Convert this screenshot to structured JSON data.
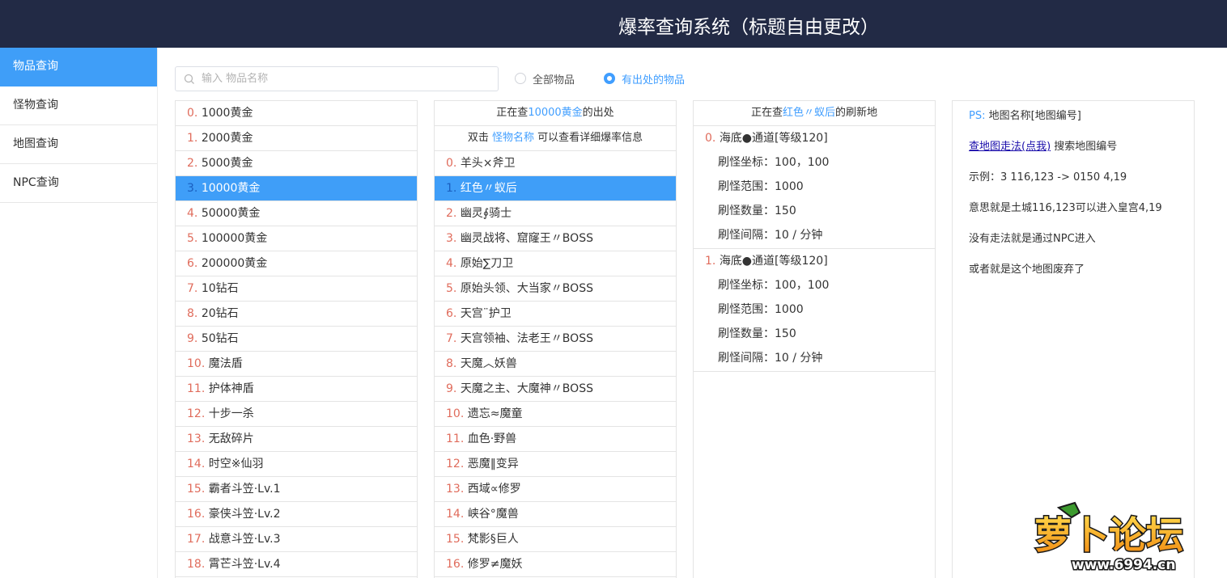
{
  "header": {
    "title": "爆率查询系统（标题自由更改）"
  },
  "sidebar": {
    "items": [
      {
        "label": "物品查询",
        "active": true
      },
      {
        "label": "怪物查询",
        "active": false
      },
      {
        "label": "地图查询",
        "active": false
      },
      {
        "label": "NPC查询",
        "active": false
      }
    ]
  },
  "search": {
    "placeholder": "输入 物品名称",
    "value": ""
  },
  "filters": {
    "all_label": "全部物品",
    "source_label": "有出处的物品",
    "selected": "source"
  },
  "items_list": [
    {
      "index": "0.",
      "name": "1000黄金"
    },
    {
      "index": "1.",
      "name": "2000黄金"
    },
    {
      "index": "2.",
      "name": "5000黄金"
    },
    {
      "index": "3.",
      "name": "10000黄金",
      "selected": true
    },
    {
      "index": "4.",
      "name": "50000黄金"
    },
    {
      "index": "5.",
      "name": "100000黄金"
    },
    {
      "index": "6.",
      "name": "200000黄金"
    },
    {
      "index": "7.",
      "name": "10钻石"
    },
    {
      "index": "8.",
      "name": "20钻石"
    },
    {
      "index": "9.",
      "name": "50钻石"
    },
    {
      "index": "10.",
      "name": "魔法盾"
    },
    {
      "index": "11.",
      "name": "护体神盾"
    },
    {
      "index": "12.",
      "name": "十步一杀"
    },
    {
      "index": "13.",
      "name": "无敌碎片"
    },
    {
      "index": "14.",
      "name": "时空※仙羽"
    },
    {
      "index": "15.",
      "name": "霸者斗笠·Lv.1"
    },
    {
      "index": "16.",
      "name": "豪侠斗笠·Lv.2"
    },
    {
      "index": "17.",
      "name": "战意斗笠·Lv.3"
    },
    {
      "index": "18.",
      "name": "霄芒斗笠·Lv.4"
    }
  ],
  "monsters_panel": {
    "head_prefix": "正在查",
    "head_item": "10000黄金",
    "head_suffix": "的出处",
    "hint_prefix": "双击 ",
    "hint_link": "怪物名称",
    "hint_suffix": " 可以查看详细爆率信息",
    "list": [
      {
        "index": "0.",
        "name": "羊头×斧卫"
      },
      {
        "index": "1.",
        "name": "红色〃蚁后",
        "selected": true
      },
      {
        "index": "2.",
        "name": "幽灵∮骑士"
      },
      {
        "index": "3.",
        "name": "幽灵战将、窟窿王〃BOSS"
      },
      {
        "index": "4.",
        "name": "原始∑刀卫"
      },
      {
        "index": "5.",
        "name": "原始头领、大当家〃BOSS"
      },
      {
        "index": "6.",
        "name": "天宫¨护卫"
      },
      {
        "index": "7.",
        "name": "天宫领袖、法老王〃BOSS"
      },
      {
        "index": "8.",
        "name": "天魔︿妖兽"
      },
      {
        "index": "9.",
        "name": "天魔之主、大魔神〃BOSS"
      },
      {
        "index": "10.",
        "name": "遗忘≈魔童"
      },
      {
        "index": "11.",
        "name": "血色·野兽"
      },
      {
        "index": "12.",
        "name": "恶魔‖变异"
      },
      {
        "index": "13.",
        "name": "西域∝修罗"
      },
      {
        "index": "14.",
        "name": "峡谷°魔兽"
      },
      {
        "index": "15.",
        "name": "梵影§巨人"
      },
      {
        "index": "16.",
        "name": "修罗≠魔妖"
      }
    ]
  },
  "maps_panel": {
    "head_prefix": "正在查",
    "head_monster": "红色〃蚁后",
    "head_suffix": "的刷新地",
    "maps": [
      {
        "index": "0.",
        "name": "海底●通道[等级120]",
        "coords": "刷怪坐标：100，100",
        "range": "刷怪范围：1000",
        "count": "刷怪数量：150",
        "interval": "刷怪间隔：10 / 分钟"
      },
      {
        "index": "1.",
        "name": "海底●通道[等级120]",
        "coords": "刷怪坐标：100，100",
        "range": "刷怪范围：1000",
        "count": "刷怪数量：150",
        "interval": "刷怪间隔：10 / 分钟"
      }
    ]
  },
  "info_panel": {
    "ps_label": "PS:",
    "ps_text": "地图名称[地图编号]",
    "link_text": "查地图走法(点我)",
    "link_suffix": " 搜索地图编号",
    "example": "示例：3 116,123 -> 0150 4,19",
    "meaning": "意思就是土城116,123可以进入皇宫4,19",
    "npc_note": "没有走法就是通过NPC进入",
    "abandoned_note": "或者就是这个地图废弃了"
  },
  "watermark": {
    "text": "萝卜论坛",
    "url_text": "www.6994.cn"
  },
  "colors": {
    "header_bg": "#222a45",
    "accent": "#3f9ef8",
    "index_red": "#e06c5c",
    "link_blue": "#409eff"
  }
}
